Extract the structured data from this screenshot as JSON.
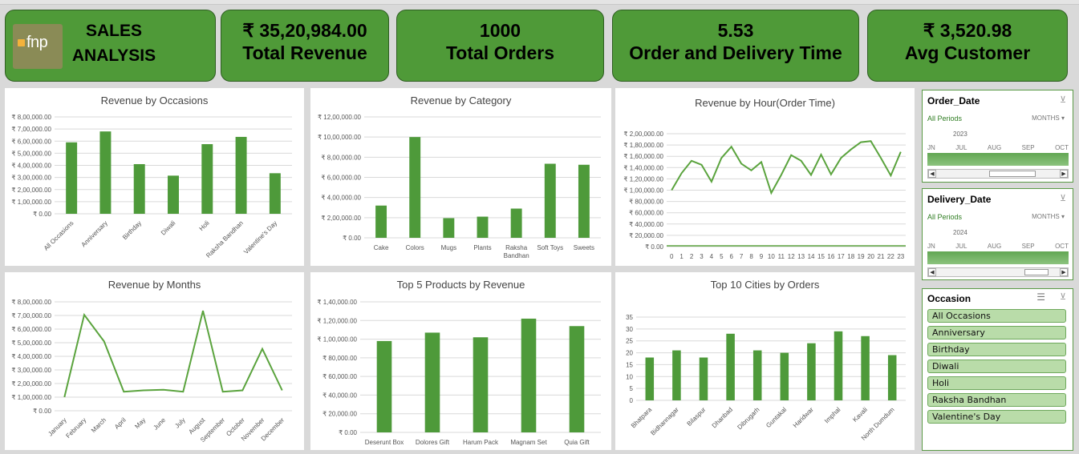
{
  "header": {
    "logo_text": "fnp",
    "title_line1": "SALES",
    "title_line2": "ANALYSIS",
    "kpis": [
      {
        "value": "₹ 35,20,984.00",
        "label": "Total Revenue"
      },
      {
        "value": "1000",
        "label": "Total Orders"
      },
      {
        "value": "5.53",
        "label": "Order and Delivery Time"
      },
      {
        "value": "₹ 3,520.98",
        "label": "Avg Customer"
      }
    ]
  },
  "colors": {
    "accent": "#4f9a38",
    "bar": "#4e9a3a",
    "line": "#5aa33d"
  },
  "chart_data": [
    {
      "id": "occasions",
      "type": "bar",
      "title": "Revenue by Occasions",
      "categories": [
        "All Occasions",
        "Anniversary",
        "Birthday",
        "Diwali",
        "Holi",
        "Raksha Bandhan",
        "Valentine's Day"
      ],
      "values": [
        590000,
        680000,
        410000,
        315000,
        575000,
        635000,
        335000
      ],
      "yticks": [
        "₹ 0.00",
        "₹ 1,00,000.00",
        "₹ 2,00,000.00",
        "₹ 3,00,000.00",
        "₹ 4,00,000.00",
        "₹ 5,00,000.00",
        "₹ 6,00,000.00",
        "₹ 7,00,000.00",
        "₹ 8,00,000.00"
      ],
      "ylim": [
        0,
        800000
      ],
      "grid": true
    },
    {
      "id": "category",
      "type": "bar",
      "title": "Revenue by Category",
      "categories": [
        "Cake",
        "Colors",
        "Mugs",
        "Plants",
        "Raksha Bandhan",
        "Soft Toys",
        "Sweets"
      ],
      "values": [
        320000,
        1000000,
        195000,
        210000,
        290000,
        735000,
        725000
      ],
      "yticks": [
        "₹ 0.00",
        "₹ 2,00,000.00",
        "₹ 4,00,000.00",
        "₹ 6,00,000.00",
        "₹ 8,00,000.00",
        "₹ 10,00,000.00",
        "₹ 12,00,000.00"
      ],
      "ylim": [
        0,
        1200000
      ],
      "grid": true
    },
    {
      "id": "hour",
      "type": "line",
      "title": "Revenue  by Hour(Order Time)",
      "categories": [
        "0",
        "1",
        "2",
        "3",
        "4",
        "5",
        "6",
        "7",
        "8",
        "9",
        "10",
        "11",
        "12",
        "13",
        "14",
        "15",
        "16",
        "17",
        "18",
        "19",
        "20",
        "21",
        "22",
        "23"
      ],
      "values": [
        100000,
        130000,
        152000,
        145000,
        115000,
        157000,
        177000,
        147000,
        135000,
        150000,
        95000,
        127000,
        162000,
        152000,
        127000,
        163000,
        128000,
        157000,
        172000,
        185000,
        187000,
        157000,
        126000,
        168000
      ],
      "yticks": [
        "₹ 0.00",
        "₹ 20,000.00",
        "₹ 40,000.00",
        "₹ 60,000.00",
        "₹ 80,000.00",
        "₹ 1,00,000.00",
        "₹ 1,20,000.00",
        "₹ 1,40,000.00",
        "₹ 1,60,000.00",
        "₹ 1,80,000.00",
        "₹ 2,00,000.00"
      ],
      "ylim": [
        0,
        200000
      ],
      "grid": true
    },
    {
      "id": "months",
      "type": "line",
      "title": "Revenue by Months",
      "categories": [
        "January",
        "February",
        "March",
        "April",
        "May",
        "June",
        "July",
        "August",
        "September",
        "October",
        "November",
        "December"
      ],
      "values": [
        100000,
        705000,
        510000,
        140000,
        150000,
        155000,
        140000,
        735000,
        140000,
        150000,
        455000,
        150000
      ],
      "yticks": [
        "₹ 0.00",
        "₹ 1,00,000.00",
        "₹ 2,00,000.00",
        "₹ 3,00,000.00",
        "₹ 4,00,000.00",
        "₹ 5,00,000.00",
        "₹ 6,00,000.00",
        "₹ 7,00,000.00",
        "₹ 8,00,000.00"
      ],
      "ylim": [
        0,
        800000
      ],
      "grid": true
    },
    {
      "id": "products",
      "type": "bar",
      "title": "Top 5 Products by Revenue",
      "categories": [
        "Deserunt Box",
        "Dolores Gift",
        "Harum Pack",
        "Magnam Set",
        "Quia Gift"
      ],
      "values": [
        98000,
        107000,
        102000,
        122000,
        114000
      ],
      "yticks": [
        "₹ 0.00",
        "₹ 20,000.00",
        "₹ 40,000.00",
        "₹ 60,000.00",
        "₹ 80,000.00",
        "₹ 1,00,000.00",
        "₹ 1,20,000.00",
        "₹ 1,40,000.00"
      ],
      "ylim": [
        0,
        140000
      ],
      "grid": true
    },
    {
      "id": "cities",
      "type": "bar",
      "title": "Top 10 Cities by Orders",
      "categories": [
        "Bhatpara",
        "Bidhannagar",
        "Bilaspur",
        "Dhanbad",
        "Dibrugarh",
        "Guntakal",
        "Haridwar",
        "Imphal",
        "Kavali",
        "North Dumdum"
      ],
      "values": [
        18,
        21,
        18,
        28,
        21,
        20,
        24,
        29,
        27,
        19
      ],
      "yticks": [
        "0",
        "5",
        "10",
        "15",
        "20",
        "25",
        "30",
        "35"
      ],
      "ylim": [
        0,
        35
      ],
      "grid": true
    }
  ],
  "slicers": {
    "order_date": {
      "title": "Order_Date",
      "all_periods": "All Periods",
      "level": "MONTHS",
      "year": "2023",
      "months": [
        "JN",
        "JUL",
        "AUG",
        "SEP",
        "OCT"
      ]
    },
    "delivery_date": {
      "title": "Delivery_Date",
      "all_periods": "All Periods",
      "level": "MONTHS",
      "year": "2024",
      "months": [
        "JN",
        "JUL",
        "AUG",
        "SEP",
        "OCT"
      ]
    },
    "occasion": {
      "title": "Occasion",
      "items": [
        "All Occasions",
        "Anniversary",
        "Birthday",
        "Diwali",
        "Holi",
        "Raksha Bandhan",
        "Valentine's Day"
      ]
    }
  }
}
